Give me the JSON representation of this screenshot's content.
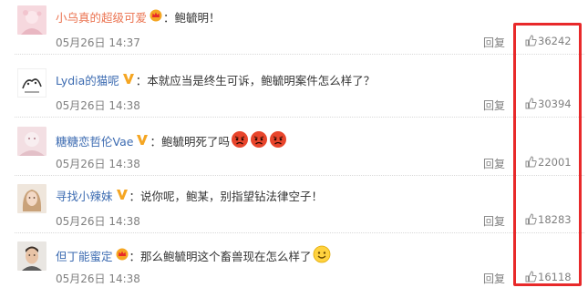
{
  "comments": [
    {
      "username": "小乌真的超级可爱",
      "badge": "crown",
      "text": "：鲍毓明！",
      "emoji": [],
      "time": "05月26日 14:37",
      "reply": "回复",
      "likes": "36242"
    },
    {
      "username": "Lydia的猫呢",
      "badge": "vip",
      "text": "：本就应当是终生可诉，鲍毓明案件怎么样了？",
      "emoji": [],
      "time": "05月26日 14:38",
      "reply": "回复",
      "likes": "30394"
    },
    {
      "username": "糖糖恋哲伦Vae",
      "badge": "vip",
      "text": "：鲍毓明死了吗",
      "emoji": [
        "angry-face-icon",
        "angry-face-icon",
        "angry-face-icon"
      ],
      "time": "05月26日 14:38",
      "reply": "回复",
      "likes": "22001"
    },
    {
      "username": "寻找小辣妹",
      "badge": "vip",
      "text": "：说你呢，鲍某，别指望钻法律空子！",
      "emoji": [],
      "time": "05月26日 14:38",
      "reply": "回复",
      "likes": "18283"
    },
    {
      "username": "但丁能蜜定",
      "badge": "crown",
      "text": "：那么鲍毓明这个畜兽现在怎么样了",
      "emoji": [
        "smile-face-icon"
      ],
      "time": "05月26日 14:38",
      "reply": "回复",
      "likes": "16118"
    }
  ],
  "colors": {
    "highlight_box": "#e8292a",
    "username": "#eb7350",
    "username_link": "#3c6bb1",
    "meta_text": "#808080"
  }
}
